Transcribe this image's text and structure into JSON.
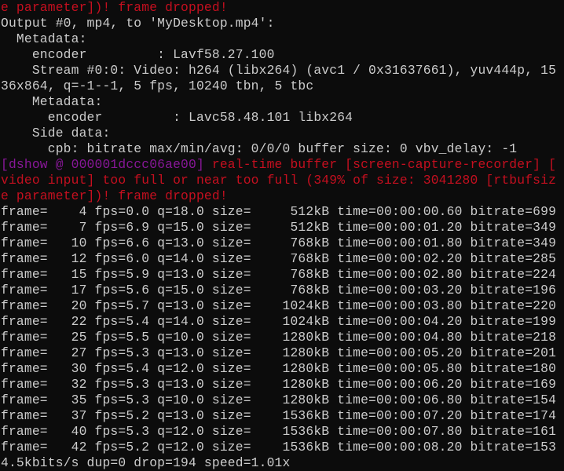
{
  "colors": {
    "background": "#0c0c0c",
    "default_text": "#cccccc",
    "error_text": "#c50f1f",
    "tag_text": "#881798"
  },
  "terminal": {
    "lines": [
      {
        "segments": [
          {
            "text": "e parameter])! frame dropped!",
            "color": "red"
          }
        ]
      },
      {
        "segments": [
          {
            "text": "Output #0, mp4, to 'MyDesktop.mp4':",
            "color": "default"
          }
        ]
      },
      {
        "segments": [
          {
            "text": "  Metadata:",
            "color": "default"
          }
        ]
      },
      {
        "segments": [
          {
            "text": "    encoder         : Lavf58.27.100",
            "color": "default"
          }
        ]
      },
      {
        "segments": [
          {
            "text": "    Stream #0:0: Video: h264 (libx264) (avc1 / 0x31637661), yuv444p, 15",
            "color": "default"
          }
        ]
      },
      {
        "segments": [
          {
            "text": "36x864, q=-1--1, 5 fps, 10240 tbn, 5 tbc",
            "color": "default"
          }
        ]
      },
      {
        "segments": [
          {
            "text": "    Metadata:",
            "color": "default"
          }
        ]
      },
      {
        "segments": [
          {
            "text": "      encoder         : Lavc58.48.101 libx264",
            "color": "default"
          }
        ]
      },
      {
        "segments": [
          {
            "text": "    Side data:",
            "color": "default"
          }
        ]
      },
      {
        "segments": [
          {
            "text": "      cpb: bitrate max/min/avg: 0/0/0 buffer size: 0 vbv_delay: -1",
            "color": "default"
          }
        ]
      },
      {
        "segments": [
          {
            "text": "[dshow @ 000001dccc06ae00] ",
            "color": "magenta"
          },
          {
            "text": "real-time buffer [screen-capture-recorder] [",
            "color": "red"
          }
        ]
      },
      {
        "segments": [
          {
            "text": "video input] too full or near too full (349% of size: 3041280 [rtbufsiz",
            "color": "red"
          }
        ]
      },
      {
        "segments": [
          {
            "text": "e parameter])! frame dropped!",
            "color": "red"
          }
        ]
      },
      {
        "segments": [
          {
            "text": "frame=    4 fps=0.0 q=18.0 size=     512kB time=00:00:00.60 bitrate=699",
            "color": "default"
          }
        ]
      },
      {
        "segments": [
          {
            "text": "frame=    7 fps=6.9 q=15.0 size=     512kB time=00:00:01.20 bitrate=349",
            "color": "default"
          }
        ]
      },
      {
        "segments": [
          {
            "text": "frame=   10 fps=6.6 q=13.0 size=     768kB time=00:00:01.80 bitrate=349",
            "color": "default"
          }
        ]
      },
      {
        "segments": [
          {
            "text": "frame=   12 fps=6.0 q=14.0 size=     768kB time=00:00:02.20 bitrate=285",
            "color": "default"
          }
        ]
      },
      {
        "segments": [
          {
            "text": "frame=   15 fps=5.9 q=13.0 size=     768kB time=00:00:02.80 bitrate=224",
            "color": "default"
          }
        ]
      },
      {
        "segments": [
          {
            "text": "frame=   17 fps=5.6 q=15.0 size=     768kB time=00:00:03.20 bitrate=196",
            "color": "default"
          }
        ]
      },
      {
        "segments": [
          {
            "text": "frame=   20 fps=5.7 q=13.0 size=    1024kB time=00:00:03.80 bitrate=220",
            "color": "default"
          }
        ]
      },
      {
        "segments": [
          {
            "text": "frame=   22 fps=5.4 q=14.0 size=    1024kB time=00:00:04.20 bitrate=199",
            "color": "default"
          }
        ]
      },
      {
        "segments": [
          {
            "text": "frame=   25 fps=5.5 q=10.0 size=    1280kB time=00:00:04.80 bitrate=218",
            "color": "default"
          }
        ]
      },
      {
        "segments": [
          {
            "text": "frame=   27 fps=5.3 q=13.0 size=    1280kB time=00:00:05.20 bitrate=201",
            "color": "default"
          }
        ]
      },
      {
        "segments": [
          {
            "text": "frame=   30 fps=5.4 q=12.0 size=    1280kB time=00:00:05.80 bitrate=180",
            "color": "default"
          }
        ]
      },
      {
        "segments": [
          {
            "text": "frame=   32 fps=5.3 q=13.0 size=    1280kB time=00:00:06.20 bitrate=169",
            "color": "default"
          }
        ]
      },
      {
        "segments": [
          {
            "text": "frame=   35 fps=5.3 q=10.0 size=    1280kB time=00:00:06.80 bitrate=154",
            "color": "default"
          }
        ]
      },
      {
        "segments": [
          {
            "text": "frame=   37 fps=5.2 q=13.0 size=    1536kB time=00:00:07.20 bitrate=174",
            "color": "default"
          }
        ]
      },
      {
        "segments": [
          {
            "text": "frame=   40 fps=5.3 q=12.0 size=    1536kB time=00:00:07.80 bitrate=161",
            "color": "default"
          }
        ]
      },
      {
        "segments": [
          {
            "text": "frame=   42 fps=5.2 q=12.0 size=    1536kB time=00:00:08.20 bitrate=153",
            "color": "default"
          }
        ]
      },
      {
        "segments": [
          {
            "text": "4.5kbits/s dup=0 drop=194 speed=1.01x",
            "color": "default"
          }
        ]
      }
    ]
  }
}
